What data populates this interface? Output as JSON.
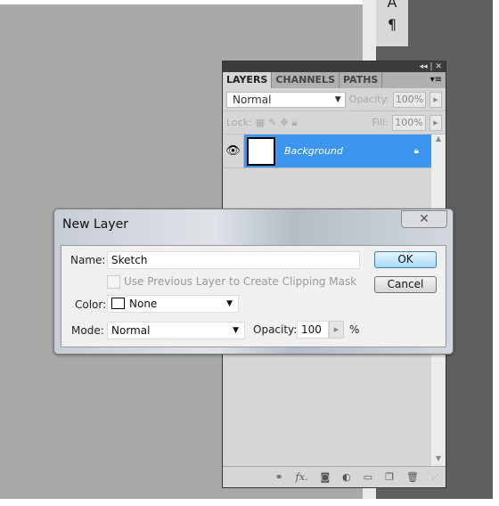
{
  "tools": {
    "top_glyph": "A",
    "paragraph_glyph": "¶"
  },
  "panel": {
    "controls": "◂◂ | ✕",
    "tabs": [
      {
        "label": "LAYERS"
      },
      {
        "label": "CHANNELS"
      },
      {
        "label": "PATHS"
      }
    ],
    "menu_icon": "▾≡",
    "blend_mode": "Normal",
    "opacity_label": "Opacity:",
    "opacity": "100%",
    "lock_label": "Lock:",
    "fill_label": "Fill:",
    "fill": "100%",
    "layers": [
      {
        "name": "Background",
        "visible": true,
        "locked": true
      }
    ]
  },
  "dialog": {
    "title": "New Layer",
    "close": "✕",
    "name_label": "Name:",
    "name_value": "Sketch",
    "clip_label": "Use Previous Layer to Create Clipping Mask",
    "color_label": "Color:",
    "color_value": "None",
    "mode_label": "Mode:",
    "mode_value": "Normal",
    "opacity_label": "Opacity:",
    "opacity_value": "100",
    "percent": "%",
    "ok": "OK",
    "cancel": "Cancel"
  },
  "colors": {
    "selection": "#3d96ee",
    "canvas": "#a9a9a9"
  }
}
